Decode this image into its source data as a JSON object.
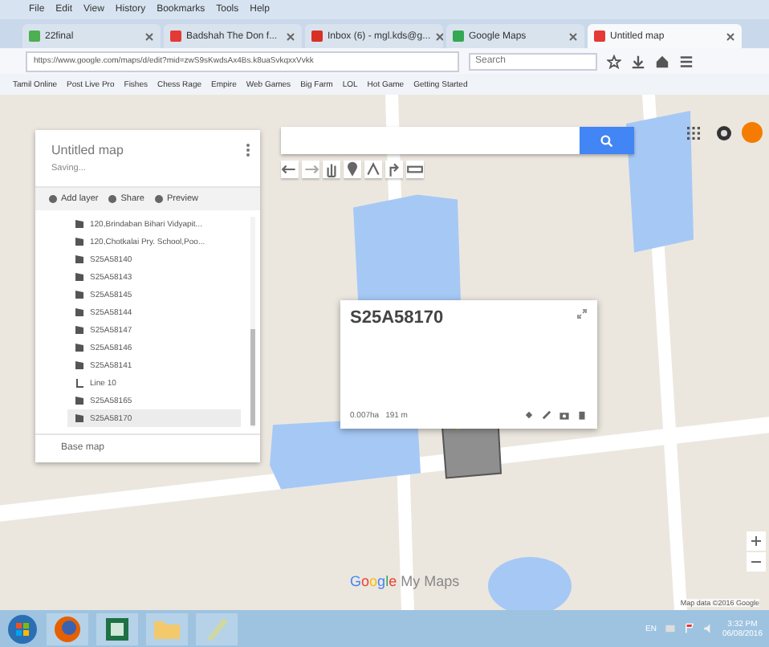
{
  "menu_bar": [
    "File",
    "Edit",
    "View",
    "History",
    "Bookmarks",
    "Tools",
    "Help"
  ],
  "tabs": [
    {
      "label": "22final",
      "selected": false,
      "color": "#4caf50"
    },
    {
      "label": "Badshah The Don f...",
      "selected": false,
      "color": "#e53935"
    },
    {
      "label": "Inbox (6) - mgl.kds@g...",
      "selected": false,
      "color": "#d93025"
    },
    {
      "label": "Google Maps",
      "selected": false,
      "color": "#34a853"
    },
    {
      "label": "Untitled map",
      "selected": true,
      "color": "#e53935"
    }
  ],
  "address_bar": {
    "url": "https://www.google.com/maps/d/edit?mid=zwS9sKwdsAx4Bs.k8uaSvkqxxVvkk",
    "search_placeholder": "Search"
  },
  "bookmarks": [
    "Tamil Online",
    "Post Live Pro",
    "Fishes",
    "Chess Rage",
    "Empire",
    "Web Games",
    "Big Farm",
    "LOL",
    "Hot Game",
    "Getting Started"
  ],
  "map_panel": {
    "title": "Untitled map",
    "status": "Saving...",
    "actions": [
      "Add layer",
      "Share",
      "Preview"
    ],
    "items": [
      {
        "kind": "place",
        "label": "120,Brindaban Bihari Vidyapit...",
        "selected": false
      },
      {
        "kind": "place",
        "label": "120,Chotkalai Pry. School,Poo...",
        "selected": false
      },
      {
        "kind": "place",
        "label": "S25A58140",
        "selected": false
      },
      {
        "kind": "place",
        "label": "S25A58143",
        "selected": false
      },
      {
        "kind": "place",
        "label": "S25A58145",
        "selected": false
      },
      {
        "kind": "place",
        "label": "S25A58144",
        "selected": false
      },
      {
        "kind": "place",
        "label": "S25A58147",
        "selected": false
      },
      {
        "kind": "place",
        "label": "S25A58146",
        "selected": false
      },
      {
        "kind": "place",
        "label": "S25A58141",
        "selected": false
      },
      {
        "kind": "line",
        "label": "Line 10",
        "selected": false
      },
      {
        "kind": "place",
        "label": "S25A58165",
        "selected": false
      },
      {
        "kind": "place",
        "label": "S25A58170",
        "selected": true
      }
    ],
    "base_map": "Base map"
  },
  "popup": {
    "title": "S25A58170",
    "area": "0.007ha",
    "perimeter": "191 m"
  },
  "branding": {
    "google": "Google",
    "product": "My Maps"
  },
  "attribution": "Map data ©2016 Google",
  "taskbar": {
    "language": "EN",
    "time": "3:32 PM",
    "date": "06/08/2016"
  }
}
